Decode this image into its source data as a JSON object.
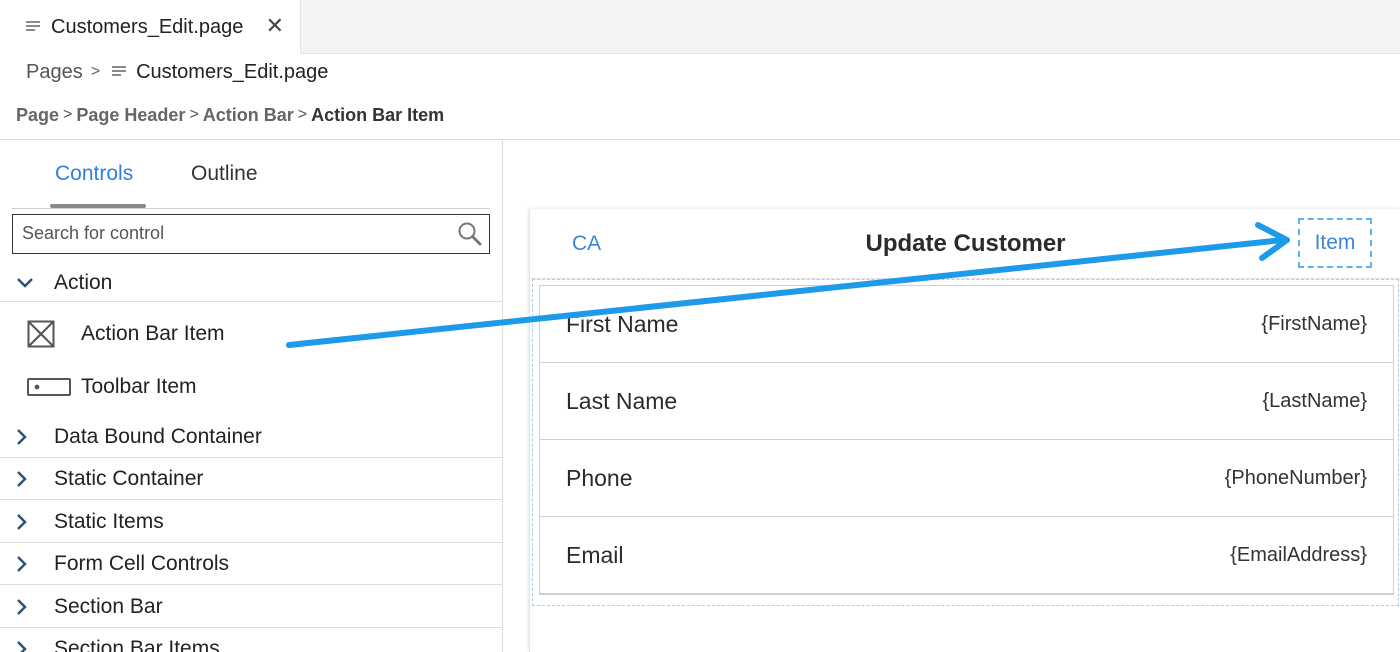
{
  "editor": {
    "tab_label": "Customers_Edit.page",
    "tab_close": "✕"
  },
  "breadcrumb": {
    "root": "Pages",
    "file": "Customers_Edit.page"
  },
  "control_path": [
    "Page",
    "Page Header",
    "Action Bar",
    "Action Bar Item"
  ],
  "panel": {
    "tab_controls": "Controls",
    "tab_outline": "Outline",
    "search_placeholder": "Search for control",
    "groups": {
      "action": "Action",
      "action_bar_item": "Action Bar Item",
      "toolbar_item": "Toolbar Item",
      "data_bound_container": "Data Bound Container",
      "static_container": "Static Container",
      "static_items": "Static Items",
      "form_cell_controls": "Form Cell Controls",
      "section_bar": "Section Bar",
      "section_bar_items": "Section Bar Items"
    }
  },
  "preview": {
    "left_action": "CA",
    "title": "Update Customer",
    "right_action": "Item",
    "fields": [
      {
        "label": "First Name",
        "value": "{FirstName}"
      },
      {
        "label": "Last Name",
        "value": "{LastName}"
      },
      {
        "label": "Phone",
        "value": "{PhoneNumber}"
      },
      {
        "label": "Email",
        "value": "{EmailAddress}"
      }
    ]
  },
  "colors": {
    "accent": "#2f7fe0",
    "arrow": "#1e9be8",
    "selection_dash": "#5fb3e8"
  }
}
